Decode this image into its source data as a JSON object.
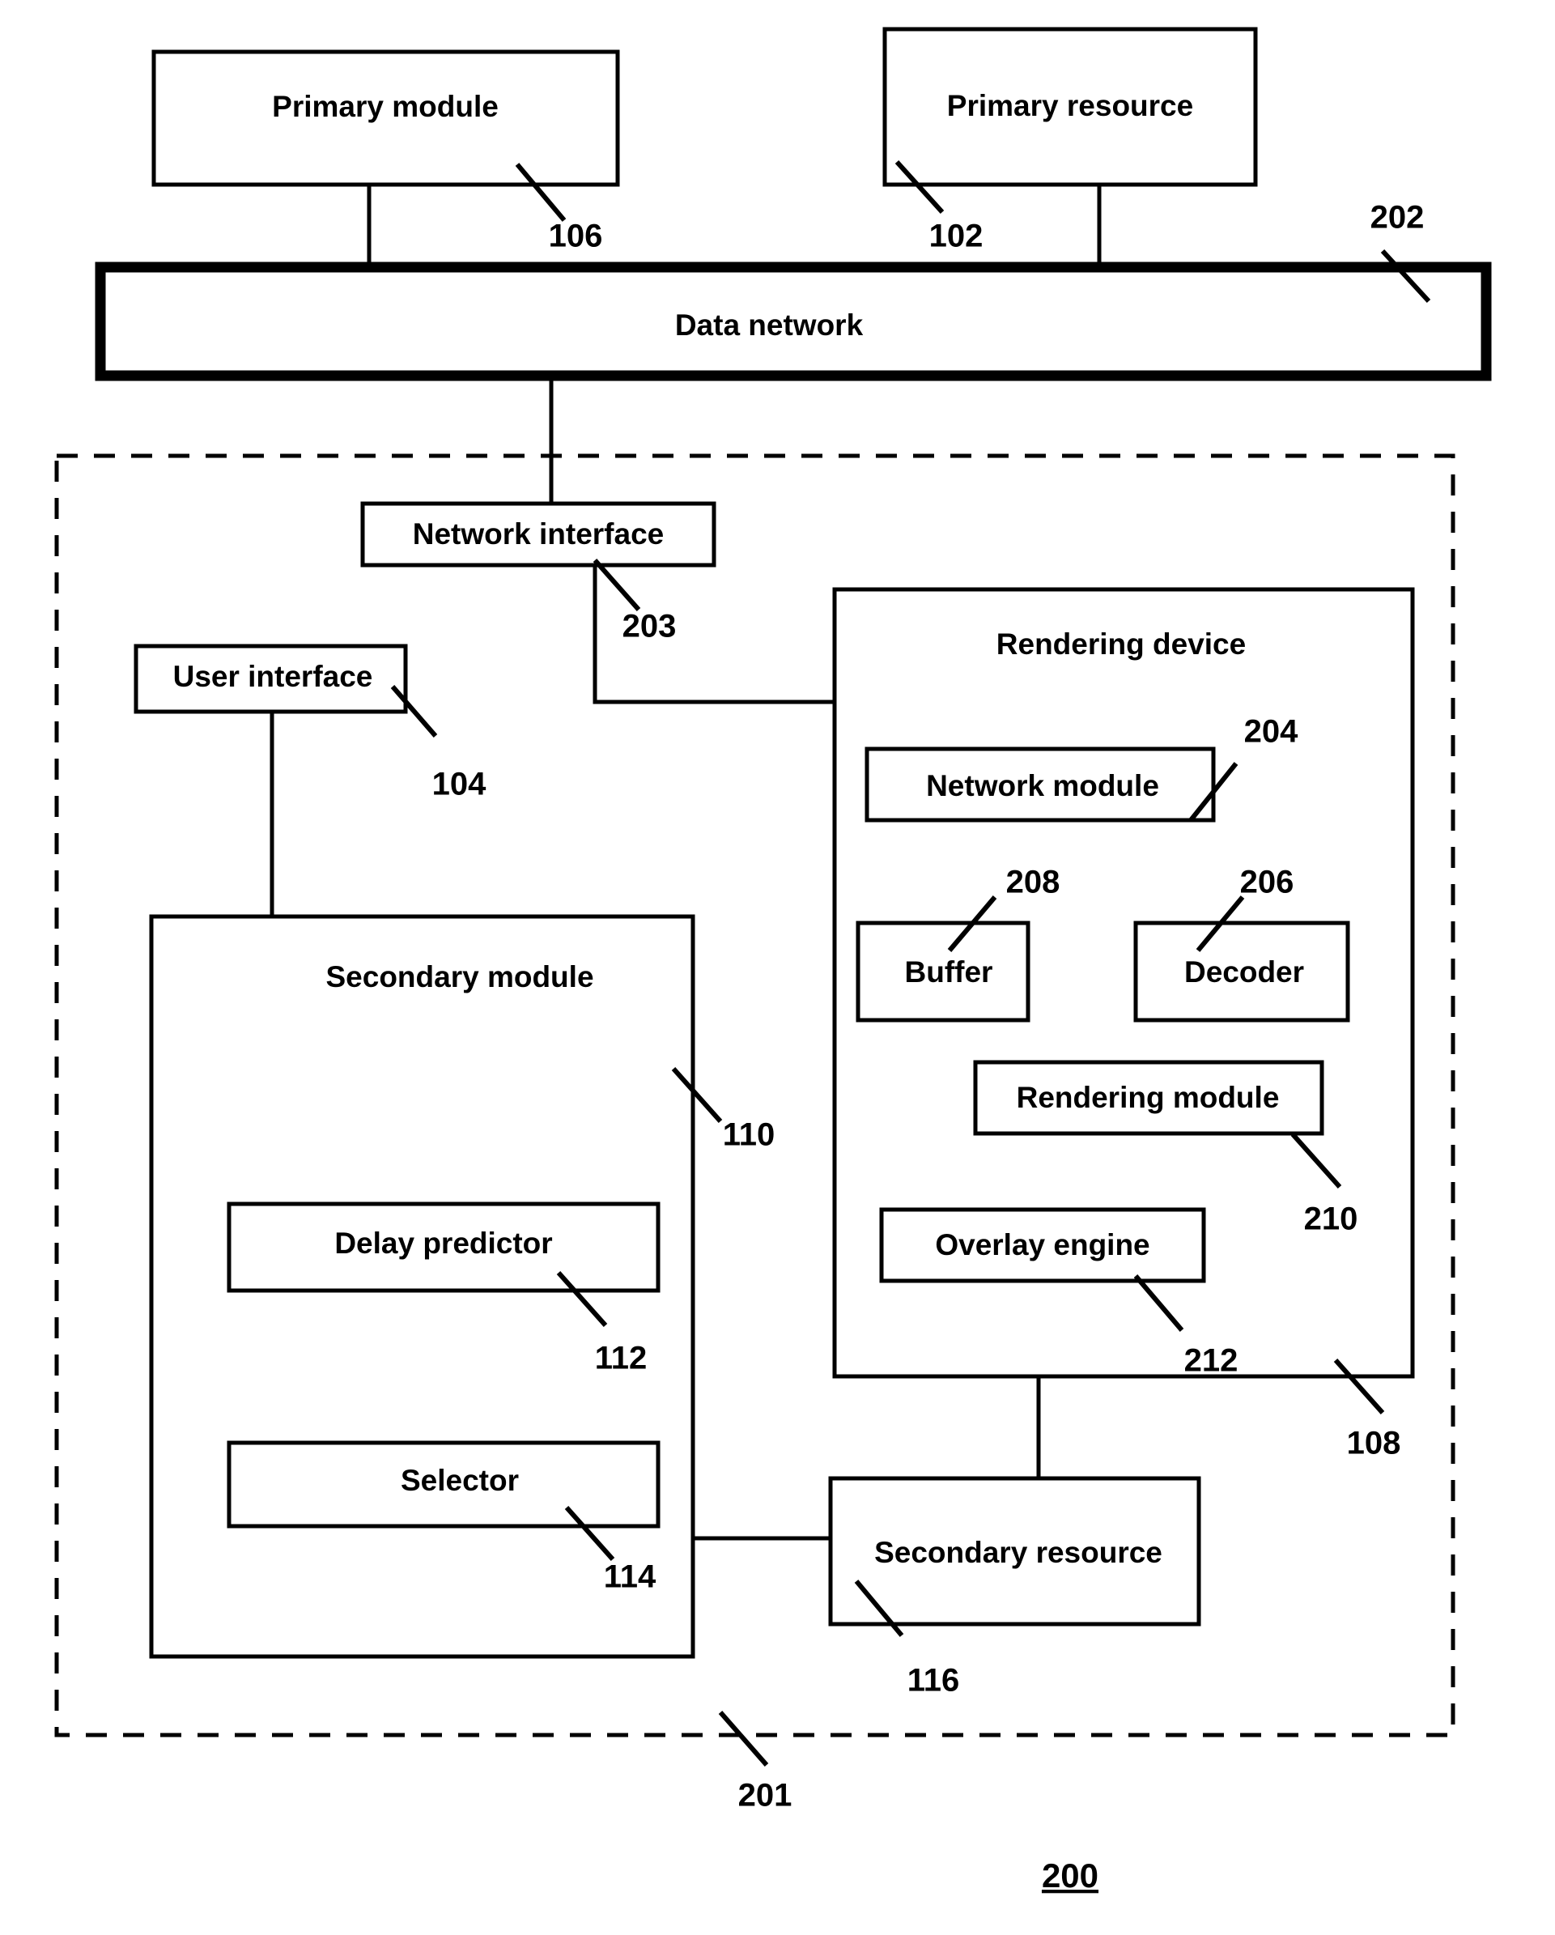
{
  "figure": {
    "number": "200",
    "type": "patent-block-diagram",
    "title": ""
  },
  "boxes": {
    "primary_module": {
      "label": "Primary module",
      "ref": "106"
    },
    "primary_resource": {
      "label": "Primary resource",
      "ref": "102"
    },
    "data_network": {
      "label": "Data network",
      "ref": "202"
    },
    "network_interface": {
      "label": "Network interface",
      "ref": "203"
    },
    "user_interface": {
      "label": "User interface",
      "ref": "104"
    },
    "secondary_module": {
      "label": "Secondary module",
      "ref": "110"
    },
    "delay_predictor": {
      "label": "Delay predictor",
      "ref": "112"
    },
    "selector": {
      "label": "Selector",
      "ref": "114"
    },
    "rendering_device": {
      "label": "Rendering device",
      "ref": "108"
    },
    "network_module": {
      "label": "Network module",
      "ref": "204"
    },
    "buffer": {
      "label": "Buffer",
      "ref": "208"
    },
    "decoder": {
      "label": "Decoder",
      "ref": "206"
    },
    "rendering_module": {
      "label": "Rendering module",
      "ref": "210"
    },
    "overlay_engine": {
      "label": "Overlay engine",
      "ref": "212"
    },
    "secondary_resource": {
      "label": "Secondary resource",
      "ref": "116"
    },
    "client_boundary": {
      "label": "",
      "ref": "201"
    }
  },
  "colors": {
    "line": "#000000",
    "background": "#ffffff",
    "text": "#000000"
  }
}
